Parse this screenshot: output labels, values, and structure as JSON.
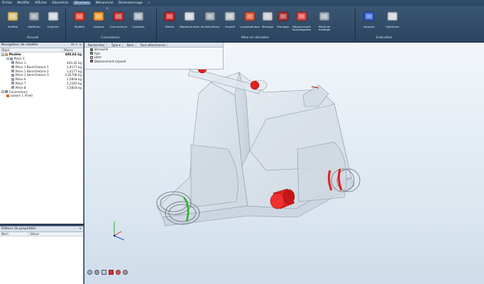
{
  "menu": {
    "items": [
      "Fichier",
      "Modifier",
      "Afficher",
      "Géométrie",
      "Structure",
      "Mécanisme",
      "Dimensionnage"
    ],
    "active_index": 4,
    "extra": "‹›"
  },
  "ribbon": {
    "buttons": [
      {
        "label": "Modèle",
        "icon": "folder-model-icon"
      },
      {
        "label": "Matériau",
        "icon": "material-icon"
      },
      {
        "label": "Explorer",
        "icon": "explorer-icon"
      },
      {
        "label": "Modèle",
        "icon": "structure-model-icon"
      },
      {
        "label": "Liaisons",
        "icon": "liaisons-icon",
        "badge": "3"
      },
      {
        "label": "Connecteurs",
        "icon": "connector-icon"
      },
      {
        "label": "Contacts",
        "icon": "contact-icon"
      },
      {
        "label": "Efforts",
        "icon": "efforts-icon"
      },
      {
        "label": "Déplacements",
        "icon": "displacement-icon"
      },
      {
        "label": "Accélérations",
        "icon": "acceleration-icon"
      },
      {
        "label": "Gravité",
        "icon": "gravity-icon"
      },
      {
        "label": "Longitudinaux",
        "icon": "longitudinal-icon"
      },
      {
        "label": "Maillage",
        "icon": "mesh-icon"
      },
      {
        "label": "Manager",
        "icon": "manager-icon"
      },
      {
        "label": "Déplacement\nhomologation",
        "icon": "homologation-icon"
      },
      {
        "label": "Modif de maillage",
        "icon": "mesh-modify-icon"
      },
      {
        "label": "Analyse",
        "icon": "analyse-icon"
      },
      {
        "label": "Optimiser",
        "icon": "optimiser-icon"
      }
    ],
    "groups": [
      "Accueil",
      "Connexions",
      "Mise en données",
      "Exécution"
    ]
  },
  "navigator": {
    "title": "Navigateur de modèle",
    "col_object": "Objet",
    "col_mass": "Masse",
    "rows": [
      {
        "level": 0,
        "label": "Modèle",
        "value": "498,84 kg",
        "bold": true,
        "icon": "model-icon",
        "expander": "−"
      },
      {
        "level": 1,
        "label": "Pièce 1",
        "value": "",
        "icon": "part-icon",
        "expander": "−"
      },
      {
        "level": 2,
        "label": "Pièce 1",
        "value": "443,32 kg",
        "icon": "part-icon"
      },
      {
        "level": 2,
        "label": "Pièce 1 Bord-Fileture 1",
        "value": "1,4177 kg",
        "icon": "part-icon"
      },
      {
        "level": 2,
        "label": "Pièce 1 Bord-Fileture 2",
        "value": "1,4177 kg",
        "icon": "part-icon"
      },
      {
        "level": 2,
        "label": "Pièce 1 Bord-Fileture 3",
        "value": "3,35708 kg",
        "icon": "part-icon"
      },
      {
        "level": 2,
        "label": "Pièce 6",
        "value": "1,5818 kg",
        "icon": "part-icon"
      },
      {
        "level": 2,
        "label": "Pièce 7",
        "value": "2,2183 kg",
        "icon": "part-icon"
      },
      {
        "level": 2,
        "label": "Pièce 8",
        "value": "1,5818 kg",
        "icon": "part-icon"
      },
      {
        "level": 0,
        "label": "Connecteurs",
        "value": "",
        "icon": "connector-icon",
        "expander": "−"
      },
      {
        "level": 1,
        "label": "Liaison 1 (Fixé)",
        "value": "",
        "icon": "bolt-icon"
      }
    ]
  },
  "properties": {
    "title": "Éditeur de propriétés",
    "col_name": "Nom",
    "col_value": "Valeur"
  },
  "loads": {
    "toolbar": [
      "Rechercher",
      "Type ▾",
      "Nom",
      "Tout sélectionner"
    ],
    "items": [
      {
        "label": "Verrouillé",
        "color": "#2aa02a"
      },
      {
        "label": "Fixé",
        "color": "#33c233"
      },
      {
        "label": "Libre",
        "color": "#d0d6dc"
      },
      {
        "label": "Déplacement imposé",
        "color": "#d82424"
      }
    ]
  },
  "colors": {
    "constraint_red": "#e41e1e",
    "constraint_green": "#23b423"
  }
}
